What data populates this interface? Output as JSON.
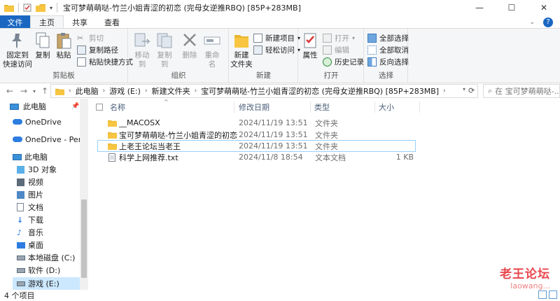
{
  "window": {
    "title": "宝可梦萌萌哒-竹兰小姐青涩的初恋 (完母女逆推RBQ) [85P+283MB]",
    "minimize": "—",
    "maximize": "☐",
    "close": "✕"
  },
  "tabs": {
    "file": "文件",
    "home": "主页",
    "share": "共享",
    "view": "查看"
  },
  "ribbon": {
    "clipboard": {
      "label": "剪贴板",
      "pin": "固定到\n快速访问",
      "copy": "复制",
      "paste": "粘贴",
      "cut": "剪切",
      "copy_path": "复制路径",
      "paste_shortcut": "粘贴快捷方式"
    },
    "organize": {
      "label": "组织",
      "move_to": "移动到",
      "copy_to": "复制到",
      "delete": "删除",
      "rename": "重命名"
    },
    "new": {
      "label": "新建",
      "new_folder": "新建\n文件夹",
      "new_item": "新建项目",
      "easy_access": "轻松访问"
    },
    "open": {
      "label": "打开",
      "properties": "属性",
      "open": "打开",
      "edit": "编辑",
      "history": "历史记录"
    },
    "select": {
      "label": "选择",
      "select_all": "全部选择",
      "select_none": "全部取消",
      "invert": "反向选择"
    }
  },
  "address": {
    "crumbs": [
      "此电脑",
      "游戏 (E:)",
      "新建文件夹",
      "宝可梦萌萌哒-竹兰小姐青涩的初恋 (完母女逆推RBQ) [85P+283MB]"
    ],
    "search_placeholder": "在 宝可梦萌萌哒-..."
  },
  "nav": {
    "items": [
      {
        "label": "此电脑",
        "icon": "computer-icon"
      },
      {
        "label": "OneDrive",
        "icon": "cloud-icon"
      },
      {
        "label": "OneDrive - Person",
        "icon": "cloud-icon"
      },
      {
        "label": "此电脑",
        "icon": "computer-icon"
      },
      {
        "label": "3D 对象",
        "icon": "cube-icon"
      },
      {
        "label": "视频",
        "icon": "video-icon"
      },
      {
        "label": "图片",
        "icon": "picture-icon"
      },
      {
        "label": "文档",
        "icon": "document-icon"
      },
      {
        "label": "下载",
        "icon": "download-icon"
      },
      {
        "label": "音乐",
        "icon": "music-icon"
      },
      {
        "label": "桌面",
        "icon": "desktop-icon"
      },
      {
        "label": "本地磁盘 (C:)",
        "icon": "drive-icon"
      },
      {
        "label": "软件 (D:)",
        "icon": "drive-icon"
      },
      {
        "label": "游戏 (E:)",
        "icon": "drive-icon"
      }
    ]
  },
  "list": {
    "columns": {
      "name": "名称",
      "modified": "修改日期",
      "type": "类型",
      "size": "大小"
    },
    "rows": [
      {
        "name": "__MACOSX",
        "modified": "2024/11/19 13:51",
        "type": "文件夹",
        "size": "",
        "icon": "folder-icon"
      },
      {
        "name": "宝可梦萌萌哒-竹兰小姐青涩的初恋 (...",
        "modified": "2024/11/19 13:51",
        "type": "文件夹",
        "size": "",
        "icon": "folder-icon"
      },
      {
        "name": "上老王论坛当老王",
        "modified": "2024/11/19 13:51",
        "type": "文件夹",
        "size": "",
        "icon": "folder-icon"
      },
      {
        "name": "科学上网推荐.txt",
        "modified": "2024/11/8 18:54",
        "type": "文本文档",
        "size": "1 KB",
        "icon": "text-file-icon"
      }
    ]
  },
  "status": {
    "count": "4 个项目"
  },
  "watermark": {
    "big": "老王论坛",
    "small": "laowang..."
  },
  "colors": {
    "accent": "#1a67c2",
    "selection": "#cce8ff",
    "folder": "#f8c542"
  }
}
